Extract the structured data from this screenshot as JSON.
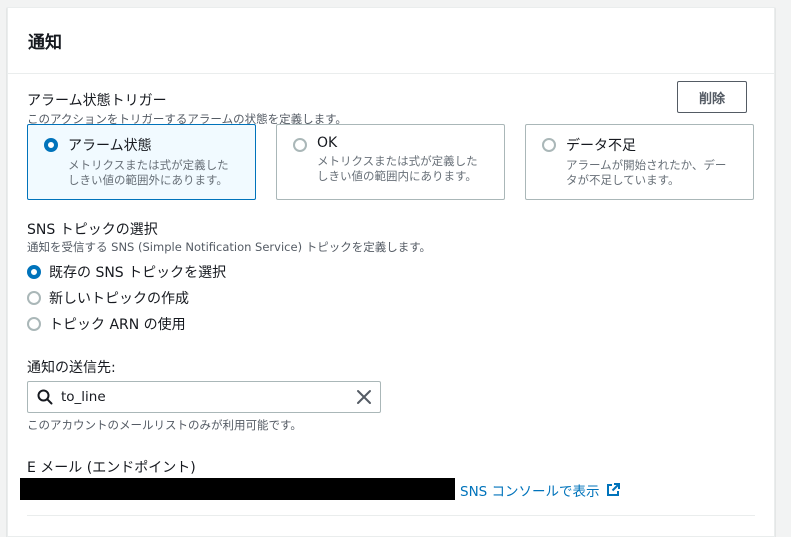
{
  "panel": {
    "title": "通知"
  },
  "alarm_trigger": {
    "label": "アラーム状態トリガー",
    "description": "このアクションをトリガーするアラームの状態を定義します。",
    "delete_label": "削除",
    "options": [
      {
        "title": "アラーム状態",
        "desc1": "メトリクスまたは式が定義した",
        "desc2": "しきい値の範囲外にあります。",
        "selected": true
      },
      {
        "title": "OK",
        "desc1": "メトリクスまたは式が定義した",
        "desc2": "しきい値の範囲内にあります。",
        "selected": false
      },
      {
        "title": "データ不足",
        "desc1": "アラームが開始されたか、デー",
        "desc2": "タが不足しています。",
        "selected": false
      }
    ]
  },
  "sns_topic": {
    "label": "SNS トピックの選択",
    "description": "通知を受信する SNS (Simple Notification Service) トピックを定義します。",
    "options": [
      {
        "label": "既存の SNS トピックを選択",
        "selected": true
      },
      {
        "label": "新しいトピックの作成",
        "selected": false
      },
      {
        "label": "トピック ARN の使用",
        "selected": false
      }
    ]
  },
  "destination": {
    "label": "通知の送信先:",
    "search_value": "to_line",
    "hint": "このアカウントのメールリストのみが利用可能です。"
  },
  "email": {
    "label": "E メール (エンドポイント)",
    "link_label": "SNS コンソールで表示"
  },
  "colors": {
    "accent": "#0073bb",
    "text": "#16191f",
    "muted": "#545b64"
  }
}
